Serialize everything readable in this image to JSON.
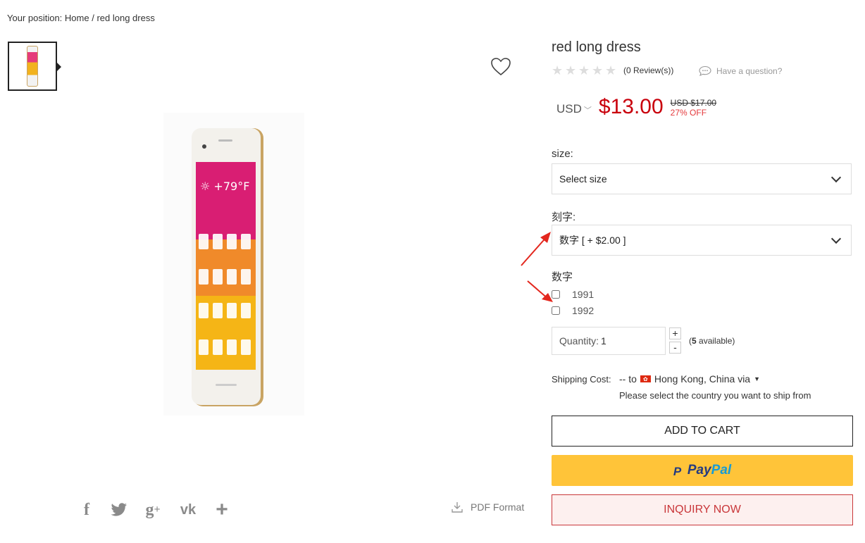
{
  "breadcrumb": {
    "prefix": "Your position: ",
    "home": "Home",
    "separator": " / ",
    "current": "red long dress"
  },
  "product": {
    "title": "red long dress",
    "reviews": "(0 Review(s))",
    "question": "Have a question?",
    "currency": "USD",
    "price": "$13.00",
    "old_price": "USD $17.00",
    "discount": "27% OFF"
  },
  "options": {
    "size_label": "size:",
    "size_value": "Select size",
    "engraving_label": "刻字:",
    "engraving_value": "数字 [ + $2.00 ]",
    "number_label": "数字",
    "number_options": [
      "1991",
      "1992"
    ]
  },
  "quantity": {
    "label": "Quantity:",
    "value": "1",
    "plus": "+",
    "minus": "-",
    "available_count": "5",
    "available_suffix": " available)",
    "available_prefix": "("
  },
  "shipping": {
    "label": "Shipping Cost:",
    "value_prefix": "-- to",
    "destination": "Hong Kong, China via",
    "note": "Please select the country you want to ship from"
  },
  "buttons": {
    "add_to_cart": "ADD TO CART",
    "paypal_1": "Pay",
    "paypal_2": "Pal",
    "paypal_mark": "P",
    "inquiry": "INQUIRY NOW"
  },
  "share": {
    "pdf": "PDF Format",
    "icons": [
      "facebook-icon",
      "twitter-icon",
      "google-plus-icon",
      "vk-icon",
      "plus-icon"
    ]
  },
  "colors": {
    "price": "#c9000c",
    "paypal": "#ffc439",
    "inquiry": "#c9373a",
    "arrow": "#e3271e"
  }
}
